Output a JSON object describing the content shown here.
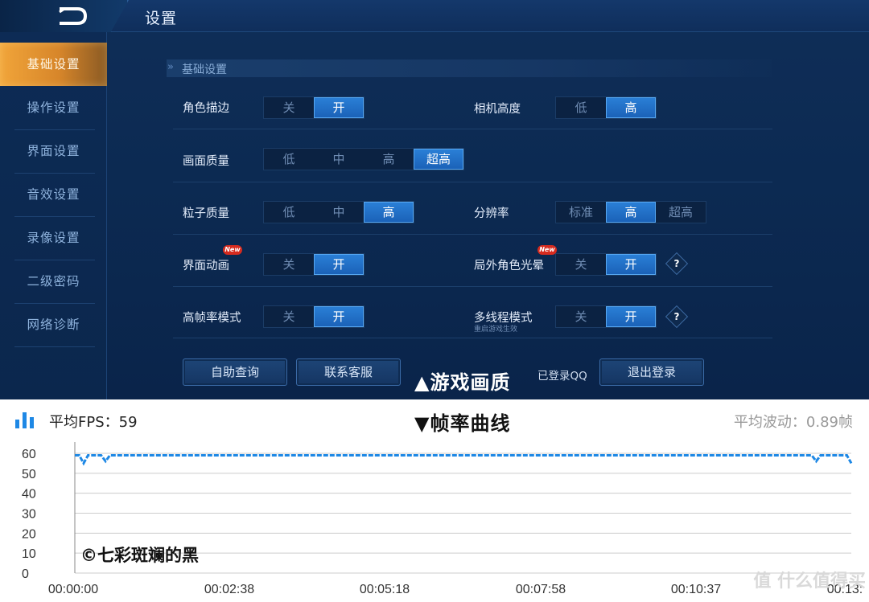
{
  "game": {
    "title": "设置",
    "sidebar": [
      {
        "label": "基础设置",
        "active": true
      },
      {
        "label": "操作设置",
        "active": false
      },
      {
        "label": "界面设置",
        "active": false
      },
      {
        "label": "音效设置",
        "active": false
      },
      {
        "label": "录像设置",
        "active": false
      },
      {
        "label": "二级密码",
        "active": false
      },
      {
        "label": "网络诊断",
        "active": false
      }
    ],
    "section_title": "基础设置",
    "settings": {
      "outline": {
        "label": "角色描边",
        "options": [
          "关",
          "开"
        ],
        "selected": 1
      },
      "camera_height": {
        "label": "相机高度",
        "options": [
          "低",
          "高"
        ],
        "selected": 1
      },
      "picture_quality": {
        "label": "画面质量",
        "options": [
          "低",
          "中",
          "高",
          "超高"
        ],
        "selected": 3
      },
      "particle_quality": {
        "label": "粒子质量",
        "options": [
          "低",
          "中",
          "高"
        ],
        "selected": 2
      },
      "resolution": {
        "label": "分辨率",
        "options": [
          "标准",
          "高",
          "超高"
        ],
        "selected": 1
      },
      "ui_animation": {
        "label": "界面动画",
        "options": [
          "关",
          "开"
        ],
        "selected": 1,
        "badge": "New"
      },
      "outside_halo": {
        "label": "局外角色光晕",
        "options": [
          "关",
          "开"
        ],
        "selected": 1,
        "badge": "New"
      },
      "high_fps": {
        "label": "高帧率模式",
        "options": [
          "关",
          "开"
        ],
        "selected": 1
      },
      "multithread": {
        "label": "多线程模式",
        "options": [
          "关",
          "开"
        ],
        "selected": 1,
        "note": "重启游戏生效"
      }
    },
    "help_glyph": "?",
    "buttons": {
      "self_help": "自助查询",
      "contact": "联系客服",
      "logout": "退出登录"
    },
    "qq_status": "已登录QQ",
    "caption_up": "▲游戏画质",
    "colors": {
      "accent": "#2a7fd6",
      "active_tab": "#f1a53a",
      "badge": "#d62b1f"
    }
  },
  "fps": {
    "avg_label": "平均FPS：59",
    "caption_down": "▼帧率曲线",
    "wave_label": "平均波动：0.89帧",
    "watermark": "©七彩斑斓的黑",
    "corner_mark": "值 什么值得买",
    "chart_data": {
      "type": "line",
      "ylim": [
        0,
        60
      ],
      "yticks": [
        "60",
        "50",
        "40",
        "30",
        "20",
        "10",
        "0"
      ],
      "xticks": [
        "00:00:00",
        "00:02:38",
        "00:05:18",
        "00:07:58",
        "00:10:37",
        "00:13:"
      ],
      "series": [
        {
          "color": "#1e88e5",
          "values": [
            59,
            59,
            55,
            59,
            59,
            59,
            59,
            56,
            59,
            59,
            59,
            59,
            59,
            59,
            59,
            59,
            59,
            59,
            59,
            59,
            59,
            59,
            59,
            59,
            59,
            59,
            59,
            59,
            59,
            59,
            59,
            59,
            59,
            59,
            59,
            59,
            59,
            59,
            59,
            59,
            59,
            59,
            59,
            59,
            59,
            59,
            59,
            59,
            59,
            59,
            59,
            59,
            59,
            59,
            59,
            59,
            59,
            59,
            59,
            59,
            59,
            59,
            59,
            59,
            59,
            59,
            59,
            59,
            59,
            59,
            59,
            59,
            59,
            59,
            59,
            59,
            59,
            59,
            59,
            59,
            59,
            59,
            59,
            59,
            59,
            59,
            59,
            59,
            59,
            59,
            59,
            59,
            59,
            59,
            59,
            59,
            59,
            59,
            59,
            59,
            59,
            59,
            59,
            59,
            59,
            59,
            59,
            59,
            59,
            59,
            59,
            59,
            59,
            59,
            59,
            59,
            59,
            59,
            59,
            59,
            59,
            59,
            59,
            59,
            59,
            59,
            59,
            59,
            59,
            59,
            59,
            59,
            59,
            59,
            59,
            59,
            59,
            59,
            59,
            59,
            59,
            59,
            59,
            59,
            59,
            59,
            59,
            59,
            59,
            59,
            59,
            59,
            59,
            59,
            59,
            59,
            59,
            59,
            59,
            59,
            59,
            59,
            59,
            59,
            59,
            59,
            59,
            59,
            59,
            56,
            59,
            59,
            59,
            59,
            59,
            59,
            59,
            55
          ]
        }
      ],
      "grid": true
    },
    "colors": {
      "line": "#1e88e5",
      "grid": "#cccccc"
    }
  }
}
